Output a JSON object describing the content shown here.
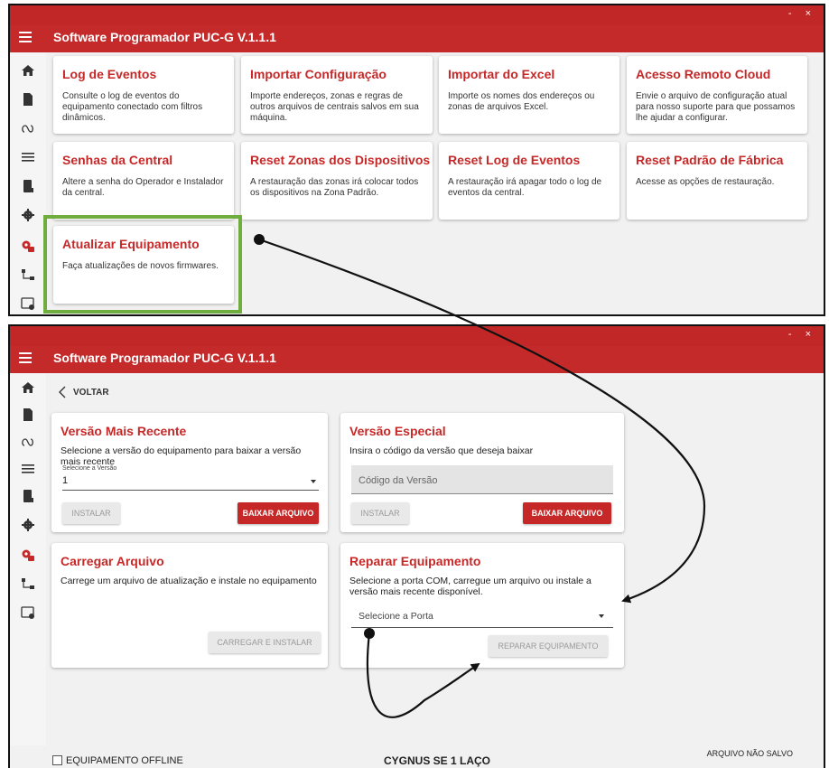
{
  "app": {
    "title": "Software Programador PUC-G V.1.1.1",
    "window_controls": "- ×"
  },
  "sidebar": {
    "icons": [
      "home-icon",
      "document-icon",
      "loop-icon",
      "list-icon",
      "book-icon",
      "gear-icon",
      "settings-active-icon",
      "network-icon",
      "window-gear-icon"
    ]
  },
  "menu_cards": [
    {
      "title": "Log de Eventos",
      "description": "Consulte o log de eventos do equipamento conectado com filtros dinâmicos."
    },
    {
      "title": "Importar Configuração",
      "description": "Importe endereços, zonas e regras de outros arquivos de centrais salvos em sua máquina."
    },
    {
      "title": "Importar do Excel",
      "description": "Importe os nomes dos endereços ou zonas de arquivos Excel."
    },
    {
      "title": "Acesso Remoto Cloud",
      "description": "Envie o arquivo de configuração atual para nosso suporte para que possamos lhe ajudar a configurar."
    },
    {
      "title": "Senhas da Central",
      "description": "Altere a senha do Operador e Instalador da central."
    },
    {
      "title": "Reset Zonas dos Dispositivos",
      "description": "A restauração das zonas irá colocar todos os dispositivos na Zona Padrão."
    },
    {
      "title": "Reset Log de Eventos",
      "description": "A restauração irá apagar todo o log de eventos da central."
    },
    {
      "title": "Reset Padrão de Fábrica",
      "description": "Acesse as opções de restauração."
    },
    {
      "title": "Atualizar Equipamento",
      "description": "Faça atualizações de novos firmwares."
    }
  ],
  "update_page": {
    "back_label": "VOLTAR",
    "latest": {
      "title": "Versão Mais Recente",
      "description": "Selecione a versão do equipamento para baixar a versão mais recente",
      "select_label": "Selecione a Versão",
      "select_value": "1",
      "install_label": "INSTALAR",
      "download_label": "BAIXAR ARQUIVO"
    },
    "special": {
      "title": "Versão Especial",
      "description": "Insira o código da versão que deseja baixar",
      "code_placeholder": "Código da Versão",
      "install_label": "INSTALAR",
      "download_label": "BAIXAR ARQUIVO"
    },
    "load_file": {
      "title": "Carregar Arquivo",
      "description": "Carrege um arquivo de atualização e instale no equipamento",
      "button_label": "CARREGAR E INSTALAR"
    },
    "repair": {
      "title": "Reparar Equipamento",
      "description": "Selecione a porta COM, carregue um arquivo ou instale a versão mais recente disponível.",
      "port_placeholder": "Selecione a Porta",
      "button_label": "REPARAR EQUIPAMENTO"
    }
  },
  "statusbar": {
    "device_status": "EQUIPAMENTO OFFLINE",
    "device_name": "CYGNUS SE 1 LAÇO",
    "file_status": "ARQUIVO NÃO SALVO"
  },
  "colors": {
    "accent": "#c62828",
    "titlebar": "#c42a2a",
    "highlight": "#6fae3e"
  }
}
